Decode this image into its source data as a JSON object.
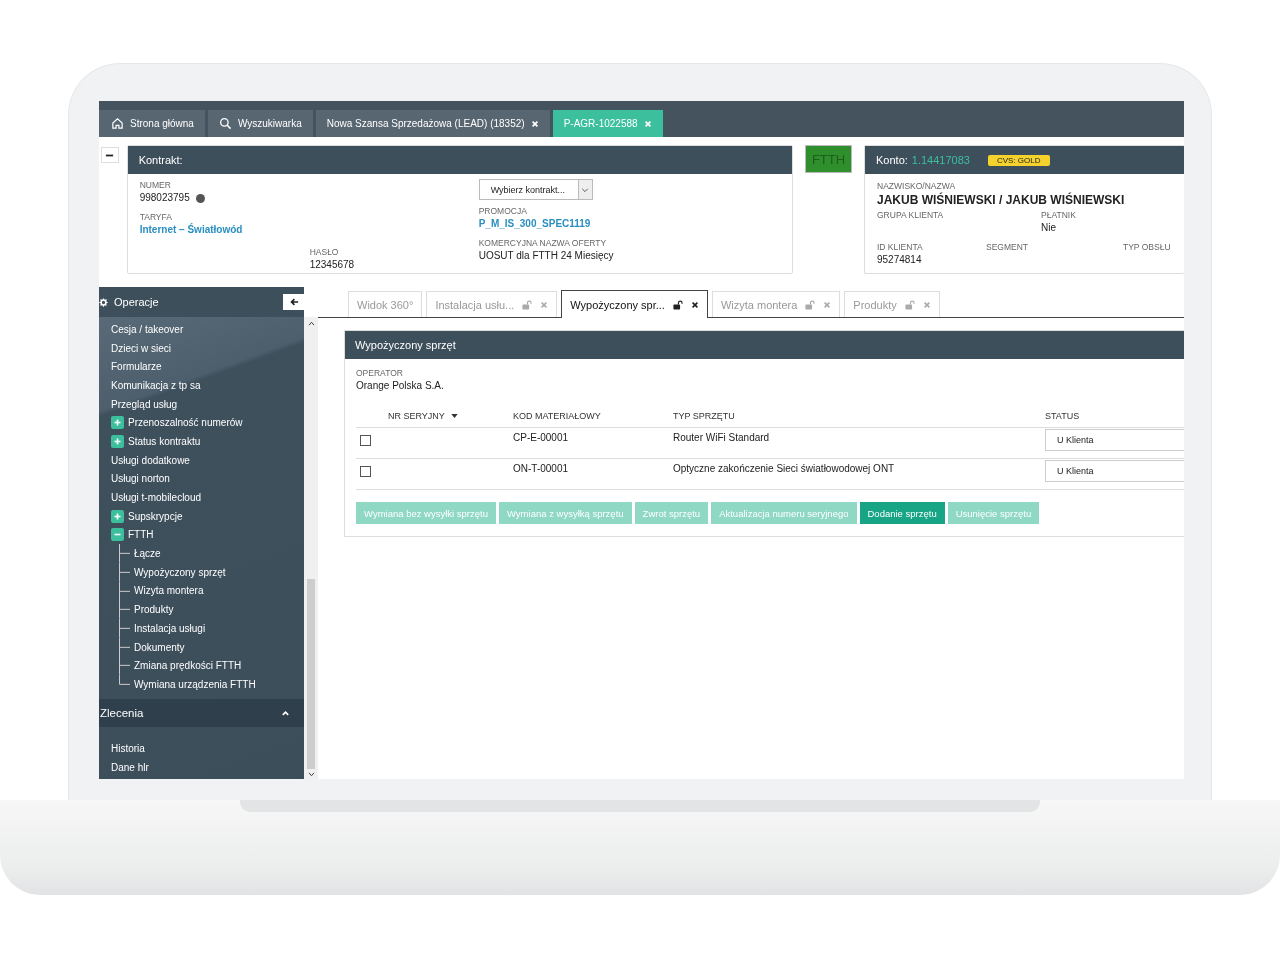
{
  "top_tabs": [
    {
      "label": "Strona główna",
      "kind": "home",
      "selected": false
    },
    {
      "label": "Wyszukiwarka",
      "kind": "search",
      "selected": false
    },
    {
      "label": "Nowa Szansa Sprzedażowa (LEAD) (18352)",
      "kind": "closable",
      "selected": false
    },
    {
      "label": "P-AGR-1022588",
      "kind": "closable",
      "selected": true
    }
  ],
  "contract": {
    "title": "Kontrakt:",
    "numer_label": "NUMER",
    "numer": "998023795",
    "select": "Wybierz kontrakt...",
    "taryfa_label": "TARYFA",
    "taryfa": "Internet – Światłowód",
    "promocja_label": "PROMOCJA",
    "promocja": "P_M_IS_300_SPEC1119",
    "haslo_label": "HASŁO",
    "haslo": "12345678",
    "oferta_label": "KOMERCYJNA NAZWA OFERTY",
    "oferta": "UOSUT dla FTTH 24 Miesięcy"
  },
  "technology_badge": "FTTH",
  "account": {
    "label": "Konto:",
    "number": "1.14417083",
    "badge": "CVS: GOLD",
    "name_label": "NAZWISKO/NAZWA",
    "name": "JAKUB WIŚNIEWSKI / JAKUB WIŚNIEWSKI",
    "group_label": "GRUPA KLIENTA",
    "payer_label": "PŁATNIK",
    "payer": "Nie",
    "id_label": "ID KLIENTA",
    "id": "95274814",
    "segment_label": "SEGMENT",
    "service_label": "TYP OBSŁU"
  },
  "sidebar": {
    "title": "Operacje",
    "items": [
      {
        "label": "Cesja / takeover",
        "kind": "link"
      },
      {
        "label": "Dzieci w sieci",
        "kind": "link"
      },
      {
        "label": "Formularze",
        "kind": "link"
      },
      {
        "label": "Komunikacja z tp sa",
        "kind": "link"
      },
      {
        "label": "Przegląd usług",
        "kind": "link"
      },
      {
        "label": "Przenoszalność numerów",
        "kind": "group",
        "expanded": false
      },
      {
        "label": "Status kontraktu",
        "kind": "group",
        "expanded": false
      },
      {
        "label": "Usługi dodatkowe",
        "kind": "link"
      },
      {
        "label": "Usługi norton",
        "kind": "link"
      },
      {
        "label": "Usługi t-mobilecloud",
        "kind": "link"
      },
      {
        "label": "Supskrypcje",
        "kind": "group",
        "expanded": false
      },
      {
        "label": "FTTH",
        "kind": "group",
        "expanded": true,
        "children": [
          {
            "label": "Łącze"
          },
          {
            "label": "Wypożyczony sprzęt"
          },
          {
            "label": "Wizyta montera"
          },
          {
            "label": "Produkty"
          },
          {
            "label": "Instalacja usługi"
          },
          {
            "label": "Dokumenty"
          },
          {
            "label": "Zmiana prędkości FTTH"
          },
          {
            "label": "Wymiana urządzenia FTTH"
          }
        ]
      }
    ],
    "section": {
      "title": "Zlecenia",
      "expanded": true,
      "items": [
        {
          "label": "Historia"
        },
        {
          "label": "Dane hlr"
        }
      ]
    }
  },
  "content_tabs": [
    {
      "label": "Widok 360°",
      "kind": "plain",
      "selected": false
    },
    {
      "label": "Instalacja usłu...",
      "kind": "closable",
      "selected": false
    },
    {
      "label": "Wypożyczony spr...",
      "kind": "closable",
      "selected": true
    },
    {
      "label": "Wizyta montera",
      "kind": "closable",
      "selected": false
    },
    {
      "label": "Produkty",
      "kind": "closable",
      "selected": false
    }
  ],
  "panel": {
    "title": "Wypożyczony sprzęt",
    "operator_label": "OPERATOR",
    "operator": "Orange Polska S.A.",
    "columns": [
      "NR SERYJNY",
      "KOD MATERIAŁOWY",
      "TYP SPRZĘTU",
      "STATUS"
    ],
    "rows": [
      {
        "checked": false,
        "code": "CP-E-00001",
        "type": "Router WiFi Standard",
        "status": "U Klienta"
      },
      {
        "checked": false,
        "code": "ON-T-00001",
        "type": "Optyczne zakończenie Sieci światłowodowej ONT",
        "status": "U Klienta"
      }
    ],
    "buttons": [
      {
        "label": "Wymiana bez wysyłki sprzętu",
        "disabled": true
      },
      {
        "label": "Wymiana z wysyłką sprzętu",
        "disabled": true
      },
      {
        "label": "Zwrot sprzętu",
        "disabled": true
      },
      {
        "label": "Aktualizacja numeru seryjnego",
        "disabled": true
      },
      {
        "label": "Dodanie sprzętu",
        "disabled": false
      },
      {
        "label": "Usunięcie sprzętu",
        "disabled": true
      }
    ]
  }
}
